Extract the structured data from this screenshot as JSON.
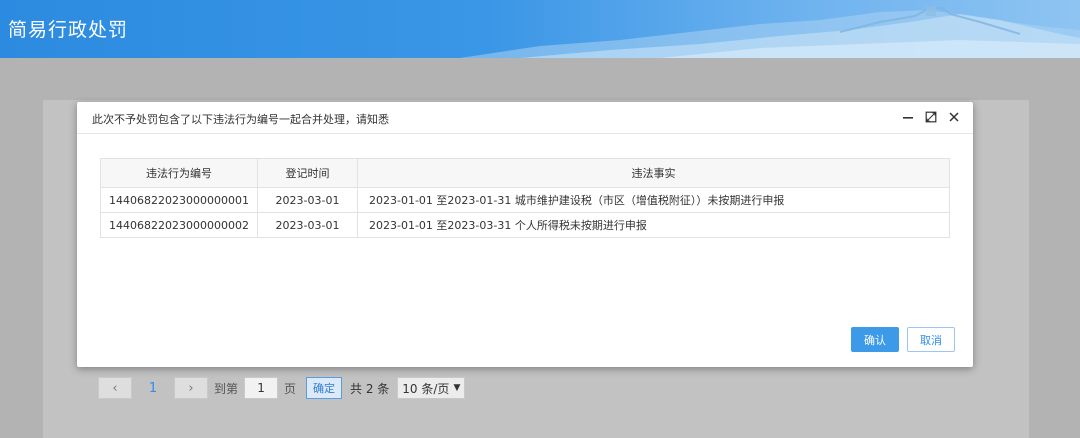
{
  "app": {
    "title": "简易行政处罚"
  },
  "pager": {
    "prev_icon": "chevron-left-icon",
    "current_page": "1",
    "next_icon": "chevron-right-icon",
    "goto_label": "到第",
    "goto_value": "1",
    "page_unit": "页",
    "confirm_label": "确定",
    "total_label": "共 2 条",
    "page_size": "10 条/页"
  },
  "modal": {
    "title": "此次不予处罚包含了以下违法行为编号一起合并处理，请知悉",
    "controls": [
      "minimize-icon",
      "maximize-icon",
      "close-icon"
    ],
    "table": {
      "headers": [
        "违法行为编号",
        "登记时间",
        "违法事实"
      ],
      "rows": [
        [
          "14406822023000000001",
          "2023-03-01",
          "2023-01-01 至2023-01-31 城市维护建设税（市区（增值税附征））未按期进行申报"
        ],
        [
          "14406822023000000002",
          "2023-03-01",
          "2023-01-01 至2023-03-31 个人所得税未按期进行申报"
        ]
      ]
    },
    "confirm_label": "确认",
    "cancel_label": "取消"
  },
  "colors": {
    "header_blue": "#2c8be0",
    "primary_button": "#3d9ae8",
    "overlay_gray": "#b3b3b3"
  }
}
